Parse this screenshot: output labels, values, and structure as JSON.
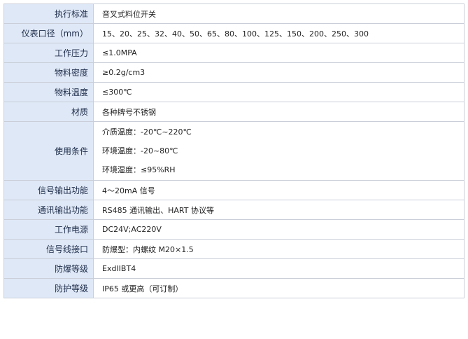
{
  "specs": [
    {
      "label": "执行标准",
      "values": [
        "音叉式料位开关"
      ]
    },
    {
      "label": "仪表口径（mm）",
      "values": [
        "15、20、25、32、40、50、65、80、100、125、150、200、250、300"
      ]
    },
    {
      "label": "工作压力",
      "values": [
        "≤1.0MPA"
      ]
    },
    {
      "label": "物料密度",
      "values": [
        "≥0.2g/cm3"
      ]
    },
    {
      "label": "物料温度",
      "values": [
        "≤300℃"
      ]
    },
    {
      "label": "材质",
      "values": [
        "各种牌号不锈钢"
      ]
    },
    {
      "label": "使用条件",
      "values": [
        "介质温度：-20℃~220℃",
        "环境温度：-20~80℃",
        "环境湿度：≤95%RH"
      ]
    },
    {
      "label": "信号输出功能",
      "values": [
        "4～20mA 信号"
      ]
    },
    {
      "label": "通讯输出功能",
      "values": [
        "RS485 通讯输出、HART 协议等"
      ]
    },
    {
      "label": "工作电源",
      "values": [
        "DC24V;AC220V"
      ]
    },
    {
      "label": "信号线接口",
      "values": [
        "防爆型：内螺纹 M20×1.5"
      ]
    },
    {
      "label": "防爆等级",
      "values": [
        "ExdIIBT4"
      ]
    },
    {
      "label": "防护等级",
      "values": [
        "IP65 或更高（可订制）"
      ]
    }
  ]
}
